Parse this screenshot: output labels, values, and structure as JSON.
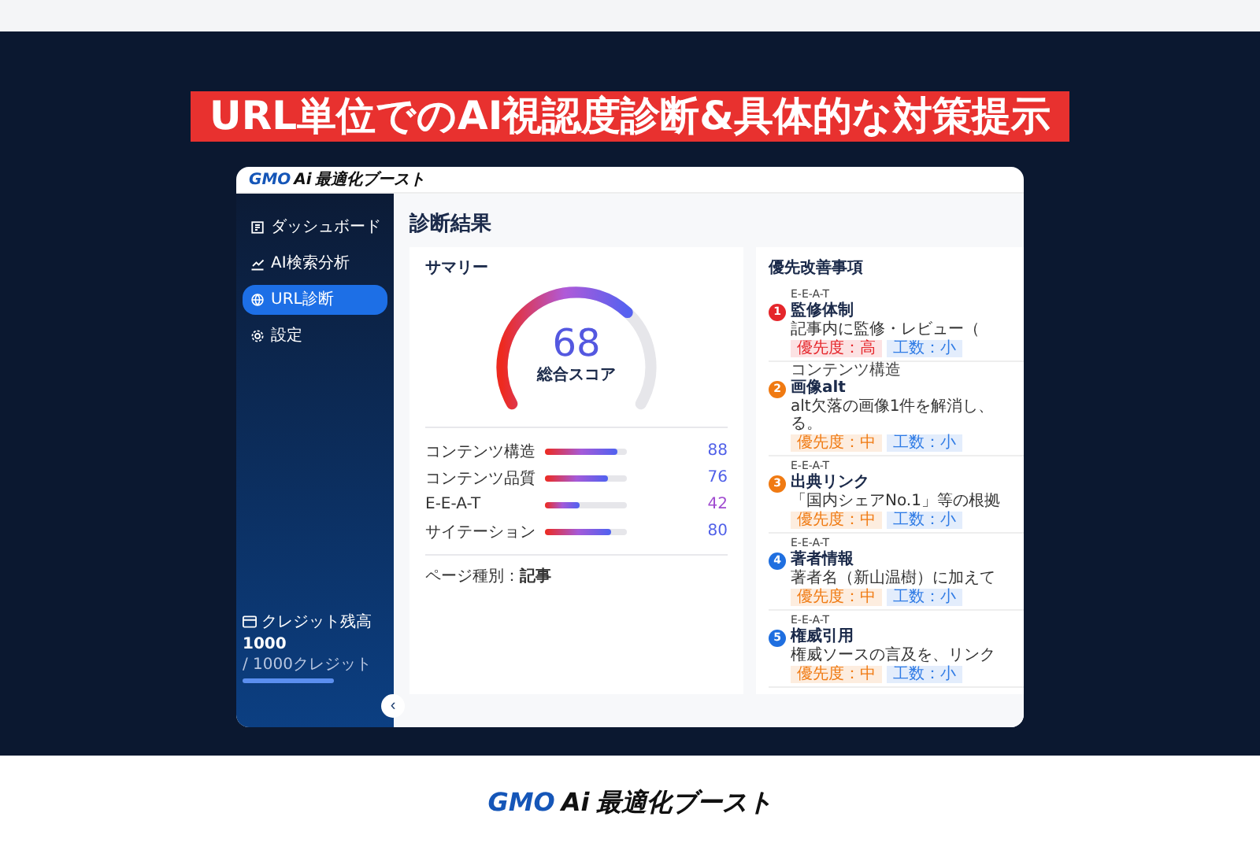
{
  "banner": {
    "title": "URL単位でのAI視認度診断&具体的な対策提示"
  },
  "app": {
    "logo": {
      "brand": "GMO",
      "ai": "Ai",
      "product": "最適化ブースト"
    },
    "sidebar": {
      "items": [
        {
          "label": "ダッシュボード",
          "selected": false
        },
        {
          "label": "AI検索分析",
          "selected": false
        },
        {
          "label": "URL診断",
          "selected": true
        },
        {
          "label": "設定",
          "selected": false
        }
      ],
      "credit": {
        "label": "クレジット残高",
        "amount": "1000",
        "total": "/ 1000クレジット",
        "level": 1
      },
      "collapse": "‹"
    },
    "page_title": "診断結果",
    "summary": {
      "title": "サマリー",
      "score": "68",
      "score_label": "総合スコア",
      "metrics": [
        {
          "name": "コンテンツ構造",
          "value": "88",
          "level": 0.88,
          "color": "#4f5fe8"
        },
        {
          "name": "コンテンツ品質",
          "value": "76",
          "level": 0.76,
          "color": "#4f5fe8"
        },
        {
          "name": "E-E-A-T",
          "value": "42",
          "level": 0.42,
          "color": "#a04bd0"
        },
        {
          "name": "サイテーション",
          "value": "80",
          "level": 0.8,
          "color": "#4f5fe8"
        }
      ],
      "page_type": "ページ種別：**記事**"
    },
    "priorities": {
      "title": "優先改善事項",
      "items": [
        {
          "number": "1",
          "color": "#e5262b",
          "category": "E-E-A-T",
          "title": "監修体制",
          "desc": [
            "記事内に監修・レビュー（"
          ],
          "tags": [
            {
              "text": "優先度：高",
              "color": "#e5262b"
            },
            {
              "text": "工数：小",
              "color": "#2f7be5"
            }
          ]
        },
        {
          "number": "2",
          "color": "#f07a12",
          "category": "コンテンツ構造",
          "title": "画像alt",
          "desc": [
            "alt欠落の画像1件を解消し、",
            "る。"
          ],
          "tags": [
            {
              "text": "優先度：中",
              "color": "#f07a12"
            },
            {
              "text": "工数：小",
              "color": "#2f7be5"
            }
          ]
        },
        {
          "number": "3",
          "color": "#f07a12",
          "category": "E-E-A-T",
          "title": "出典リンク",
          "desc": [
            "「国内シェアNo.1」等の根拠"
          ],
          "tags": [
            {
              "text": "優先度：中",
              "color": "#f07a12"
            },
            {
              "text": "工数：小",
              "color": "#2f7be5"
            }
          ]
        },
        {
          "number": "4",
          "color": "#1f6fe0",
          "category": "E-E-A-T",
          "title": "著者情報",
          "desc": [
            "著者名（新山温樹）に加えて"
          ],
          "tags": [
            {
              "text": "優先度：中",
              "color": "#f07a12"
            },
            {
              "text": "工数：小",
              "color": "#2f7be5"
            }
          ]
        },
        {
          "number": "5",
          "color": "#1f6fe0",
          "category": "E-E-A-T",
          "title": "権威引用",
          "desc": [
            "権威ソースの言及を、リンク"
          ],
          "tags": [
            {
              "text": "優先度：中",
              "color": "#f07a12"
            },
            {
              "text": "工数：小",
              "color": "#2f7be5"
            }
          ]
        }
      ]
    }
  },
  "footer": {
    "logo": {
      "brand": "GMO",
      "ai": "Ai",
      "product": "最適化ブースト"
    }
  }
}
